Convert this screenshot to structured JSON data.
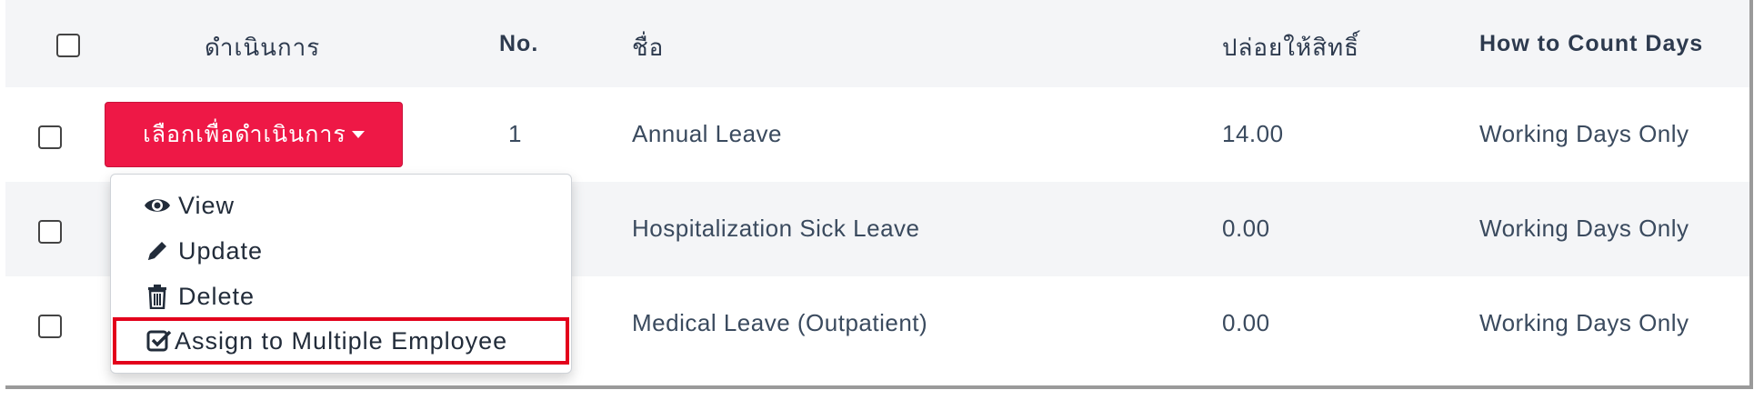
{
  "table": {
    "headers": {
      "action": "ดำเนินการ",
      "no": "No.",
      "name": "ชื่อ",
      "entitlement": "ปล่อยให้สิทธิ์",
      "count_days": "How to Count Days"
    },
    "rows": [
      {
        "no": "1",
        "name": "Annual Leave",
        "entitlement": "14.00",
        "count_days": "Working Days Only"
      },
      {
        "no": "",
        "name": "Hospitalization Sick Leave",
        "entitlement": "0.00",
        "count_days": "Working Days Only"
      },
      {
        "no": "",
        "name": "Medical Leave (Outpatient)",
        "entitlement": "0.00",
        "count_days": "Working Days Only"
      }
    ]
  },
  "action_button": {
    "label": "เลือกเพื่อดำเนินการ"
  },
  "dropdown": {
    "items": [
      {
        "label": "View",
        "icon": "eye-icon"
      },
      {
        "label": "Update",
        "icon": "pencil-icon"
      },
      {
        "label": "Delete",
        "icon": "trash-icon"
      },
      {
        "label": "Assign to Multiple Employee",
        "icon": "check-square-icon"
      }
    ]
  },
  "colors": {
    "accent": "#ee1846",
    "highlight_border": "#e3001b",
    "stripe": "#f4f5f7",
    "text": "#3a4a5e"
  }
}
